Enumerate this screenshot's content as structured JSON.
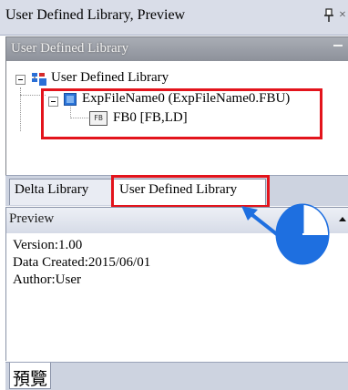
{
  "window": {
    "title": "User Defined Library, Preview",
    "pin_icon": "pin-icon",
    "close_label": "×"
  },
  "library_panel": {
    "header": "User Defined Library",
    "tree": {
      "root_label": "User Defined Library",
      "file_label": "ExpFileName0 (ExpFileName0.FBU)",
      "block_icon_text": "FB",
      "block_label": "FB0 [FB,LD]"
    }
  },
  "tabs": [
    {
      "label": "Delta Library",
      "selected": false
    },
    {
      "label": "User Defined Library",
      "selected": true
    }
  ],
  "preview": {
    "header": "Preview",
    "lines": [
      "Version:1.00",
      "Data Created:2015/06/01",
      "Author:User"
    ]
  },
  "bottom_tab": {
    "label": "預覽"
  },
  "colors": {
    "highlight_red": "#e3141c",
    "callout_blue": "#1e6fe0",
    "panel_header_gray": "#9a9ea6"
  }
}
